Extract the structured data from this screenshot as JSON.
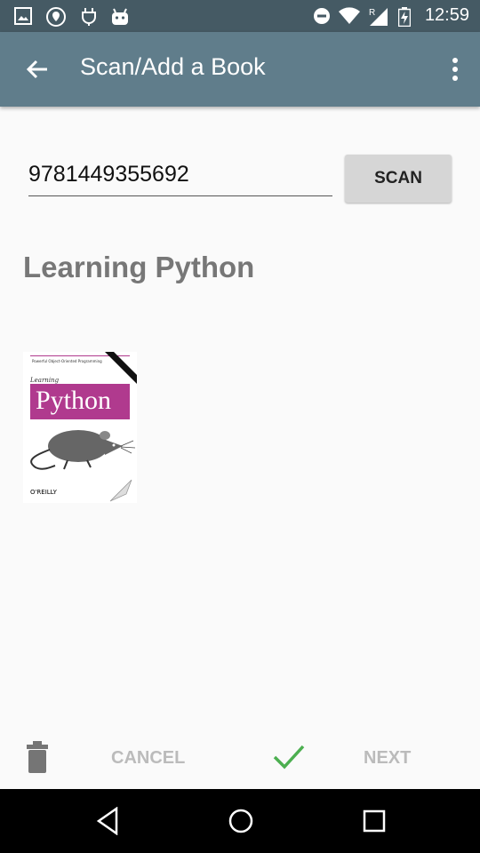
{
  "status_bar": {
    "time": "12:59",
    "icons": [
      "image-icon",
      "location-shield-icon",
      "plug-icon",
      "android-icon",
      "dnd-minus-icon",
      "wifi-icon",
      "roaming-signal-icon",
      "battery-charging-icon"
    ]
  },
  "app_bar": {
    "title": "Scan/Add a Book",
    "back_icon": "arrow-back-icon",
    "overflow_icon": "more-vert-icon"
  },
  "form": {
    "isbn_value": "9781449355692",
    "scan_label": "SCAN"
  },
  "book": {
    "title": "Learning Python",
    "cover": {
      "tagline": "Powerful Object-Oriented Programming",
      "learning_word": "Learning",
      "python_word": "Python",
      "publisher": "O'REILLY"
    }
  },
  "bottom_actions": {
    "delete_icon": "trash-icon",
    "cancel_label": "CANCEL",
    "confirm_icon": "check-icon",
    "next_label": "NEXT",
    "confirm_color": "#4caf50"
  },
  "nav_bar": {
    "back_icon": "nav-back-triangle-icon",
    "home_icon": "nav-home-circle-icon",
    "recents_icon": "nav-recents-square-icon"
  }
}
